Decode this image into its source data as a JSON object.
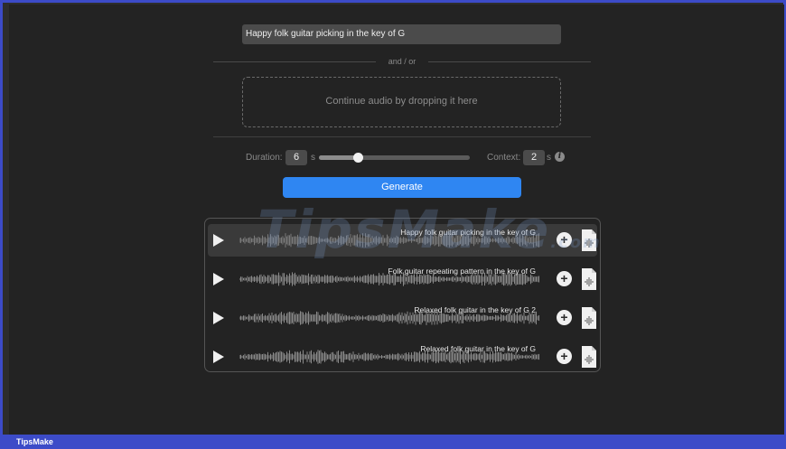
{
  "prompt": {
    "value": "Happy folk guitar picking in the key of G"
  },
  "divider_label": "and / or",
  "dropzone_label": "Continue audio by dropping it here",
  "controls": {
    "duration_label": "Duration:",
    "duration_value": "6",
    "duration_unit": "s",
    "slider_level": 0.26,
    "context_label": "Context:",
    "context_value": "2",
    "context_unit": "s",
    "info_glyph": "i"
  },
  "generate_label": "Generate",
  "results": [
    {
      "title": "Happy folk guitar picking in the key of G",
      "icon_play": "play-icon",
      "icon_add": "plus-circle-icon",
      "icon_file": "audio-file-icon"
    },
    {
      "title": "Folk guitar repeating pattern in the key of G",
      "icon_play": "play-icon",
      "icon_add": "plus-circle-icon",
      "icon_file": "audio-file-icon"
    },
    {
      "title": "Relaxed folk guitar in the key of G 2",
      "icon_play": "play-icon",
      "icon_add": "plus-circle-icon",
      "icon_file": "audio-file-icon"
    },
    {
      "title": "Relaxed folk guitar in the key of G",
      "icon_play": "play-icon",
      "icon_add": "plus-circle-icon",
      "icon_file": "audio-file-icon"
    }
  ],
  "add_glyph": "+",
  "watermark": {
    "main": "TipsMake",
    "suffix": ".com"
  },
  "footer_brand": "TipsMake",
  "colors": {
    "accent": "#2f86f2",
    "frame": "#3c4bc8",
    "background": "#232323"
  }
}
